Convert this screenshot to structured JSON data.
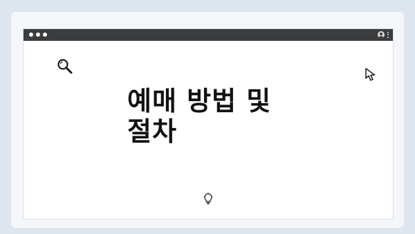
{
  "headline": {
    "line1": "예매 방법 및",
    "line2": "절차"
  },
  "icons": {
    "search": "search-icon",
    "cursor": "cursor-arrow-icon",
    "lightbulb": "lightbulb-icon",
    "user": "user-icon",
    "menu": "kebab-menu-icon"
  },
  "colors": {
    "background": "#dde5ee",
    "card": "#f4f6f9",
    "titlebar": "#3b3c3e",
    "window": "#ffffff",
    "text": "#111111"
  }
}
